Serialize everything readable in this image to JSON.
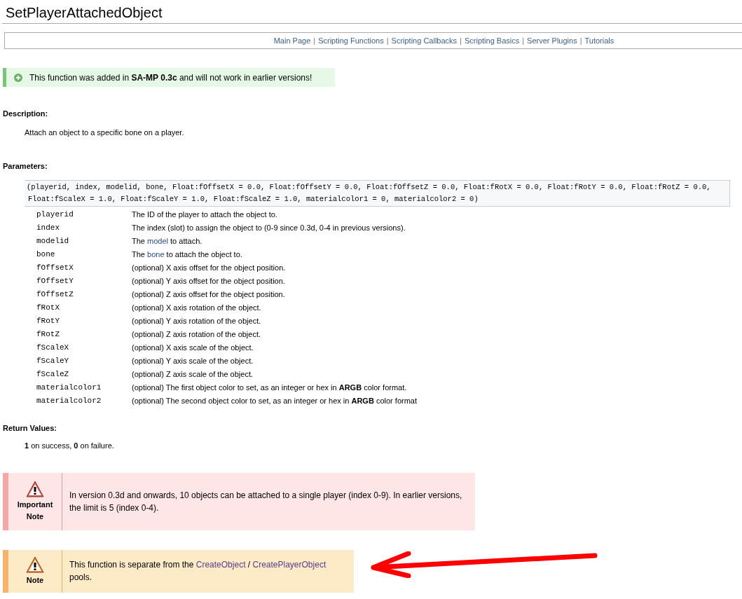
{
  "title": "SetPlayerAttachedObject",
  "nav": [
    "Main Page",
    "Scripting Functions",
    "Scripting Callbacks",
    "Scripting Basics",
    "Server Plugins",
    "Tutorials"
  ],
  "nav_separator": "|",
  "version_notice": "This function was added in **SA-MP 0.3c** and will not work in earlier versions!",
  "description": {
    "heading": "Description:",
    "text": "Attach an object to a specific bone on a player."
  },
  "parameters": {
    "heading": "Parameters:",
    "signature": "(playerid, index, modelid, bone, Float:fOffsetX = 0.0, Float:fOffsetY = 0.0, Float:fOffsetZ = 0.0, Float:fRotX = 0.0, Float:fRotY = 0.0, Float:fRotZ = 0.0, Float:fScaleX = 1.0, Float:fScaleY = 1.0, Float:fScaleZ = 1.0, materialcolor1 = 0, materialcolor2 = 0)",
    "rows": [
      {
        "name": "playerid",
        "parts": [
          {
            "kind": "text",
            "text": "The ID of the player to attach the object to."
          }
        ]
      },
      {
        "name": "index",
        "parts": [
          {
            "kind": "text",
            "text": "The index (slot) to assign the object to (0-9 since 0.3d, 0-4 in previous versions)."
          }
        ]
      },
      {
        "name": "modelid",
        "parts": [
          {
            "kind": "text",
            "text": "The"
          },
          {
            "kind": "link",
            "text": "model"
          },
          {
            "kind": "text",
            "text": "to attach."
          }
        ]
      },
      {
        "name": "bone",
        "parts": [
          {
            "kind": "text",
            "text": "The"
          },
          {
            "kind": "link",
            "text": "bone"
          },
          {
            "kind": "text",
            "text": "to attach the object to."
          }
        ]
      },
      {
        "name": "fOffsetX",
        "parts": [
          {
            "kind": "text",
            "text": "(optional) X axis offset for the object position."
          }
        ]
      },
      {
        "name": "fOffsetY",
        "parts": [
          {
            "kind": "text",
            "text": "(optional) Y axis offset for the object position."
          }
        ]
      },
      {
        "name": "fOffsetZ",
        "parts": [
          {
            "kind": "text",
            "text": "(optional) Z axis offset for the object position."
          }
        ]
      },
      {
        "name": "fRotX",
        "parts": [
          {
            "kind": "text",
            "text": "(optional) X axis rotation of the object."
          }
        ]
      },
      {
        "name": "fRotY",
        "parts": [
          {
            "kind": "text",
            "text": "(optional) Y axis rotation of the object."
          }
        ]
      },
      {
        "name": "fRotZ",
        "parts": [
          {
            "kind": "text",
            "text": "(optional) Z axis rotation of the object."
          }
        ]
      },
      {
        "name": "fScaleX",
        "parts": [
          {
            "kind": "text",
            "text": "(optional) X axis scale of the object."
          }
        ]
      },
      {
        "name": "fScaleY",
        "parts": [
          {
            "kind": "text",
            "text": "(optional) Y axis scale of the object."
          }
        ]
      },
      {
        "name": "fScaleZ",
        "parts": [
          {
            "kind": "text",
            "text": "(optional) Z axis scale of the object."
          }
        ]
      },
      {
        "name": "materialcolor1",
        "parts": [
          {
            "kind": "text",
            "text": "(optional) The first object color to set, as an integer or hex in **ARGB** color format."
          }
        ]
      },
      {
        "name": "materialcolor2",
        "parts": [
          {
            "kind": "text",
            "text": "(optional) The second object color to set, as an integer or hex in **ARGB** color format"
          }
        ]
      }
    ]
  },
  "return_values": {
    "heading": "Return Values:",
    "text": "**1** on success, **0** on failure."
  },
  "notes": [
    {
      "kind": "important",
      "label": "Important Note",
      "parts": [
        {
          "kind": "text",
          "text": "In version 0.3d and onwards, 10 objects can be attached to a single player (index 0-9). In earlier versions, the limit is 5 (index 0-4)."
        }
      ]
    },
    {
      "kind": "note",
      "label": "Note",
      "parts": [
        {
          "kind": "text",
          "text": "This function is separate from the"
        },
        {
          "kind": "link",
          "text": "CreateObject"
        },
        {
          "kind": "text",
          "text": "/"
        },
        {
          "kind": "link",
          "text": "CreatePlayerObject"
        },
        {
          "kind": "text",
          "text": "pools."
        }
      ]
    }
  ]
}
